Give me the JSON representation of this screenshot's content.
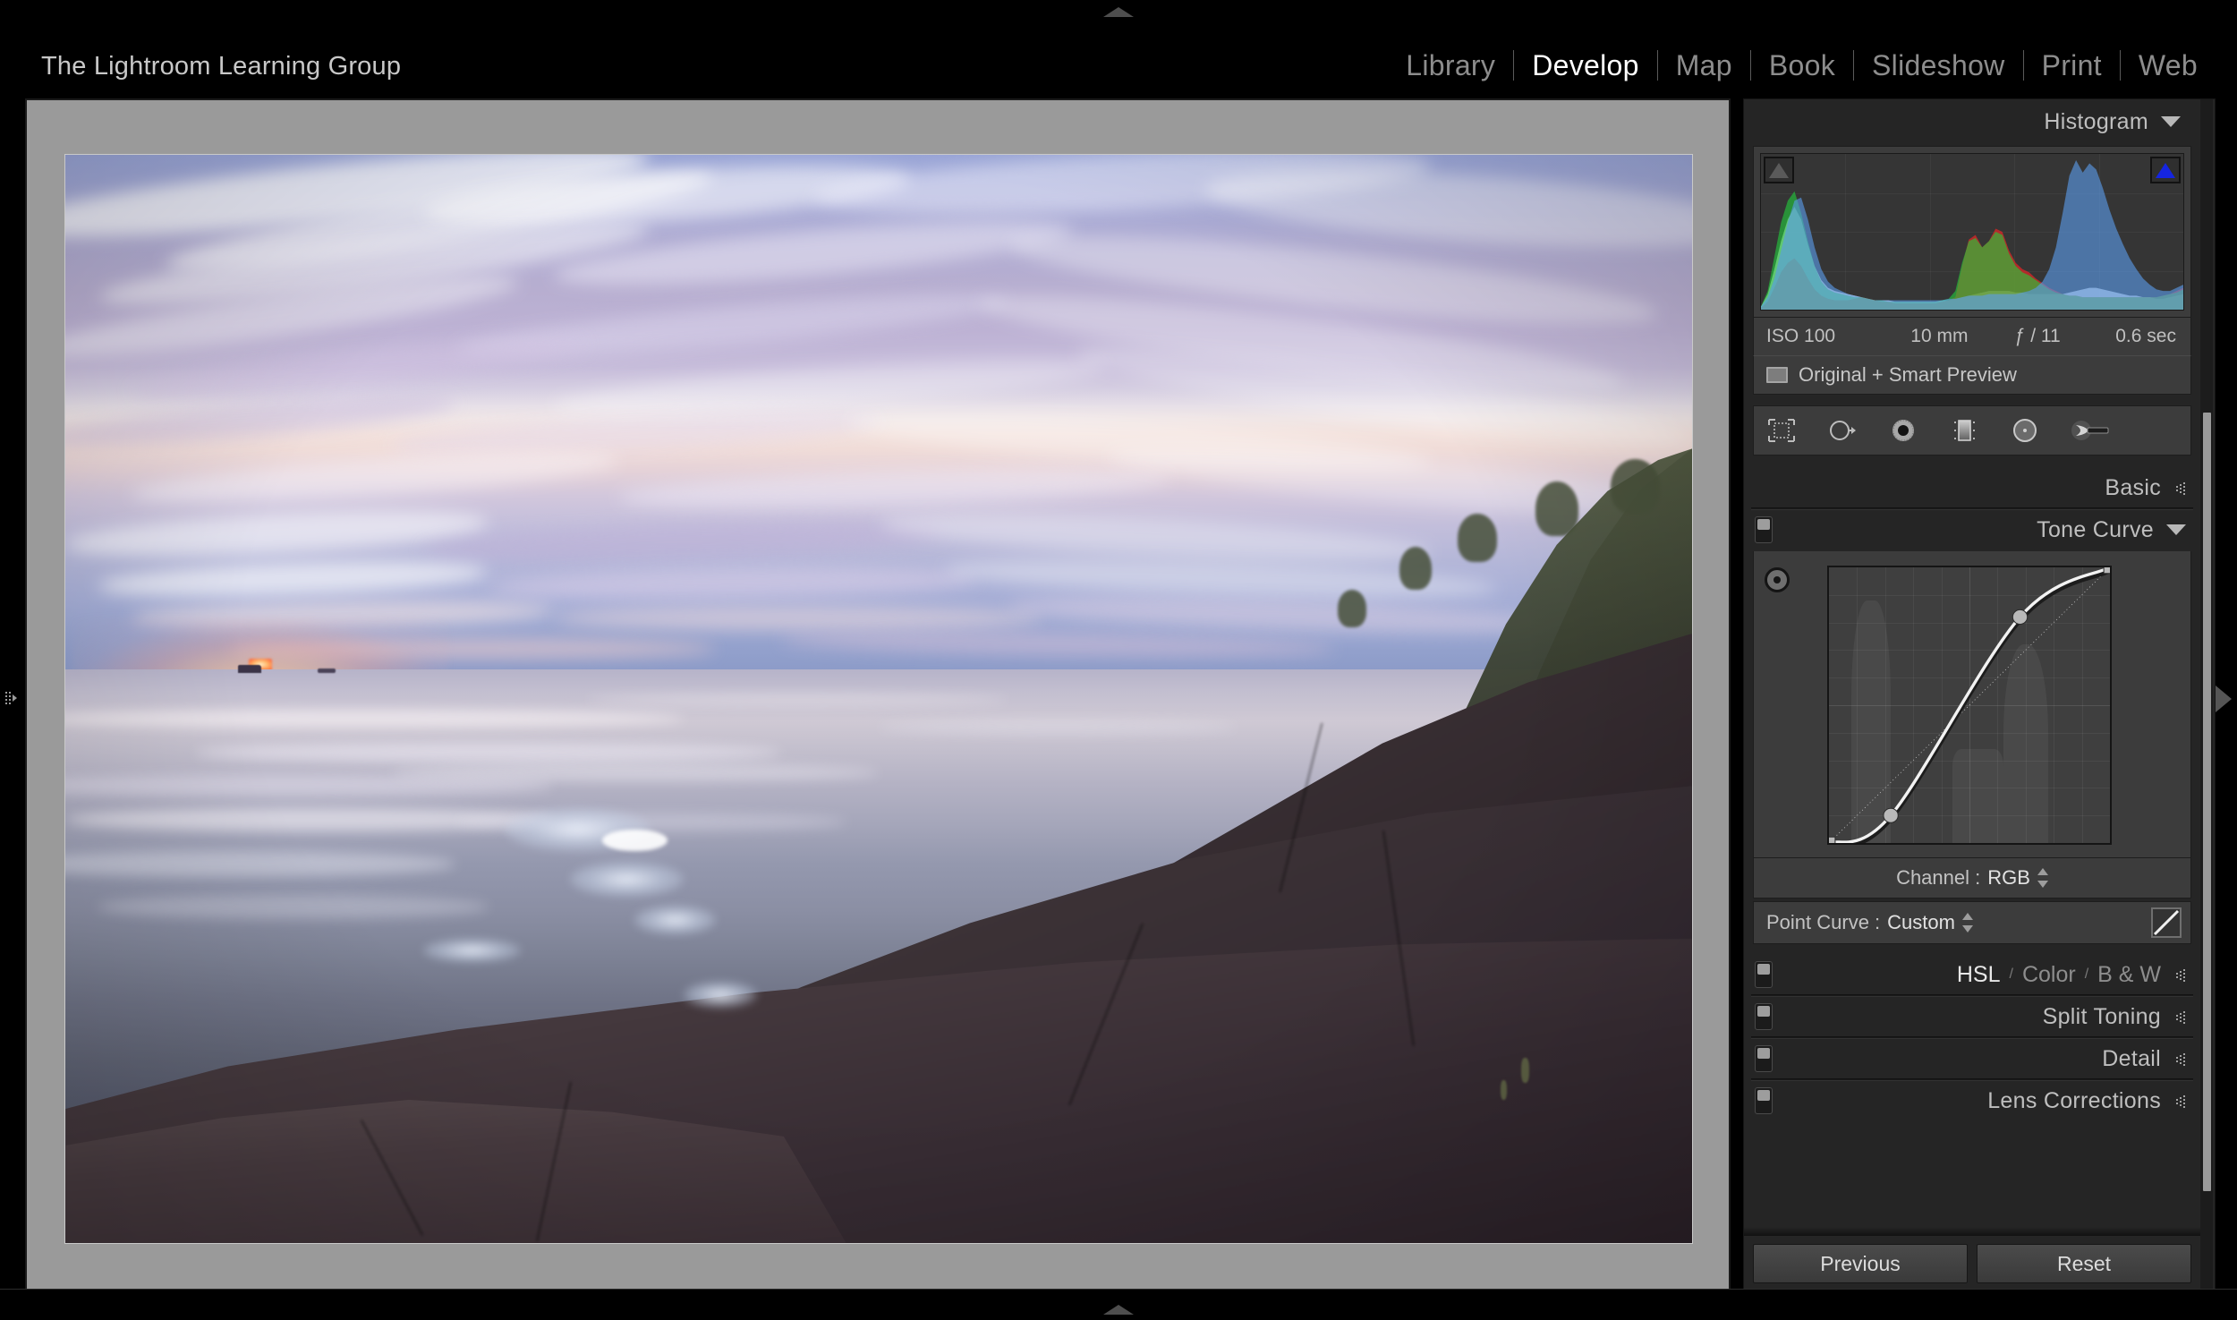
{
  "app": {
    "identity_plate": "The Lightroom Learning Group",
    "active_module": "Develop"
  },
  "module_picker": {
    "items": [
      {
        "label": "Library",
        "active": false
      },
      {
        "label": "Develop",
        "active": true
      },
      {
        "label": "Map",
        "active": false
      },
      {
        "label": "Book",
        "active": false
      },
      {
        "label": "Slideshow",
        "active": false
      },
      {
        "label": "Print",
        "active": false
      },
      {
        "label": "Web",
        "active": false
      }
    ]
  },
  "histogram": {
    "title": "Histogram",
    "shadow_clip_icon": "triangle-up-icon",
    "highlight_clip_icon": "triangle-up-icon",
    "highlight_clip_color": "#1525e0",
    "shadow_clip_color": "#5a5a5a",
    "exif": {
      "iso": "ISO 100",
      "focal_length": "10 mm",
      "aperture": "ƒ / 11",
      "shutter_speed": "0.6 sec"
    },
    "preview_status": "Original + Smart Preview"
  },
  "chart_data": {
    "type": "area",
    "title": "Histogram",
    "xlabel": "",
    "ylabel": "",
    "xlim": [
      0,
      255
    ],
    "ylim": [
      0,
      100
    ],
    "grid": true,
    "legend": "none",
    "series": [
      {
        "name": "Luminance (grey)",
        "color": "#d2d2d2",
        "values": [
          2,
          10,
          26,
          44,
          58,
          66,
          58,
          42,
          28,
          19,
          14,
          12,
          11,
          10,
          9,
          8,
          7,
          6,
          6,
          6,
          5,
          5,
          5,
          5,
          5,
          5,
          5,
          6,
          6,
          7,
          8,
          9,
          10,
          11,
          12,
          12,
          12,
          12,
          11,
          11,
          10,
          10,
          10,
          10,
          10,
          10,
          11,
          12,
          13,
          14,
          14,
          13,
          12,
          11,
          10,
          9,
          9,
          8,
          8,
          7,
          7,
          8,
          9,
          10
        ]
      },
      {
        "name": "Red",
        "color": "#ff2424",
        "values": [
          1,
          5,
          14,
          24,
          30,
          33,
          28,
          20,
          13,
          9,
          7,
          6,
          6,
          6,
          7,
          8,
          7,
          6,
          5,
          5,
          4,
          4,
          4,
          4,
          4,
          4,
          4,
          5,
          6,
          8,
          28,
          45,
          48,
          40,
          44,
          52,
          50,
          38,
          30,
          26,
          24,
          20,
          17,
          14,
          12,
          10,
          9,
          9,
          8,
          8,
          8,
          8,
          8,
          8,
          8,
          8,
          8,
          8,
          8,
          8,
          9,
          10,
          12,
          14
        ]
      },
      {
        "name": "Green",
        "color": "#22c93c",
        "values": [
          2,
          12,
          34,
          56,
          70,
          76,
          62,
          44,
          28,
          18,
          13,
          11,
          10,
          9,
          8,
          8,
          7,
          6,
          6,
          5,
          5,
          5,
          5,
          5,
          5,
          5,
          5,
          6,
          7,
          12,
          30,
          44,
          46,
          40,
          44,
          50,
          48,
          36,
          28,
          24,
          22,
          19,
          16,
          13,
          11,
          10,
          9,
          9,
          8,
          8,
          8,
          8,
          8,
          8,
          8,
          8,
          8,
          8,
          8,
          8,
          9,
          10,
          11,
          13
        ]
      },
      {
        "name": "Blue",
        "color": "#5a9bea",
        "values": [
          2,
          8,
          20,
          38,
          56,
          70,
          72,
          58,
          40,
          26,
          18,
          14,
          12,
          10,
          9,
          8,
          7,
          6,
          6,
          6,
          6,
          6,
          6,
          6,
          6,
          6,
          6,
          6,
          7,
          7,
          8,
          9,
          9,
          9,
          10,
          10,
          10,
          10,
          10,
          11,
          12,
          14,
          18,
          26,
          40,
          62,
          86,
          96,
          88,
          94,
          90,
          78,
          64,
          52,
          42,
          33,
          26,
          20,
          16,
          13,
          12,
          12,
          14,
          16
        ]
      }
    ],
    "notes": "RGB overlay histogram; shadows cluster left, yellow midtone hump, strong blue highlight peak"
  },
  "tool_strip": {
    "tools": [
      {
        "name": "crop-overlay-tool",
        "label": "Crop Overlay",
        "active": false
      },
      {
        "name": "spot-removal-tool",
        "label": "Spot Removal",
        "active": false
      },
      {
        "name": "red-eye-correction-tool",
        "label": "Red Eye Correction",
        "active": false
      },
      {
        "name": "graduated-filter-tool",
        "label": "Graduated Filter",
        "active": false
      },
      {
        "name": "radial-filter-tool",
        "label": "Radial Filter",
        "active": false
      },
      {
        "name": "adjustment-brush-tool",
        "label": "Adjustment Brush",
        "active": false
      }
    ]
  },
  "panels": {
    "basic": {
      "title": "Basic",
      "expanded": false,
      "has_switch": false
    },
    "tone_curve": {
      "title": "Tone Curve",
      "expanded": true,
      "has_switch": true,
      "channel_label": "Channel :",
      "channel_value": "RGB",
      "point_curve_label": "Point Curve :",
      "point_curve_value": "Custom",
      "curve_points": [
        {
          "x": 0,
          "y": 0
        },
        {
          "x": 22,
          "y": 10
        },
        {
          "x": 68,
          "y": 82
        },
        {
          "x": 100,
          "y": 100
        }
      ]
    },
    "hsl": {
      "title_parts": [
        "HSL",
        "Color",
        "B & W"
      ],
      "active_part": "HSL",
      "expanded": false,
      "has_switch": true
    },
    "split_toning": {
      "title": "Split Toning",
      "expanded": false,
      "has_switch": true
    },
    "detail": {
      "title": "Detail",
      "expanded": false,
      "has_switch": true
    },
    "lens_corrections": {
      "title": "Lens Corrections",
      "expanded": false,
      "has_switch": true
    }
  },
  "footer_buttons": {
    "previous": "Previous",
    "reset": "Reset"
  },
  "colors": {
    "panel_bg": "#252525",
    "module_bg": "#3c3c3c",
    "content_bg": "#9a9a9a",
    "accent_text": "#ffffff",
    "muted_text": "#8d8d8d"
  }
}
